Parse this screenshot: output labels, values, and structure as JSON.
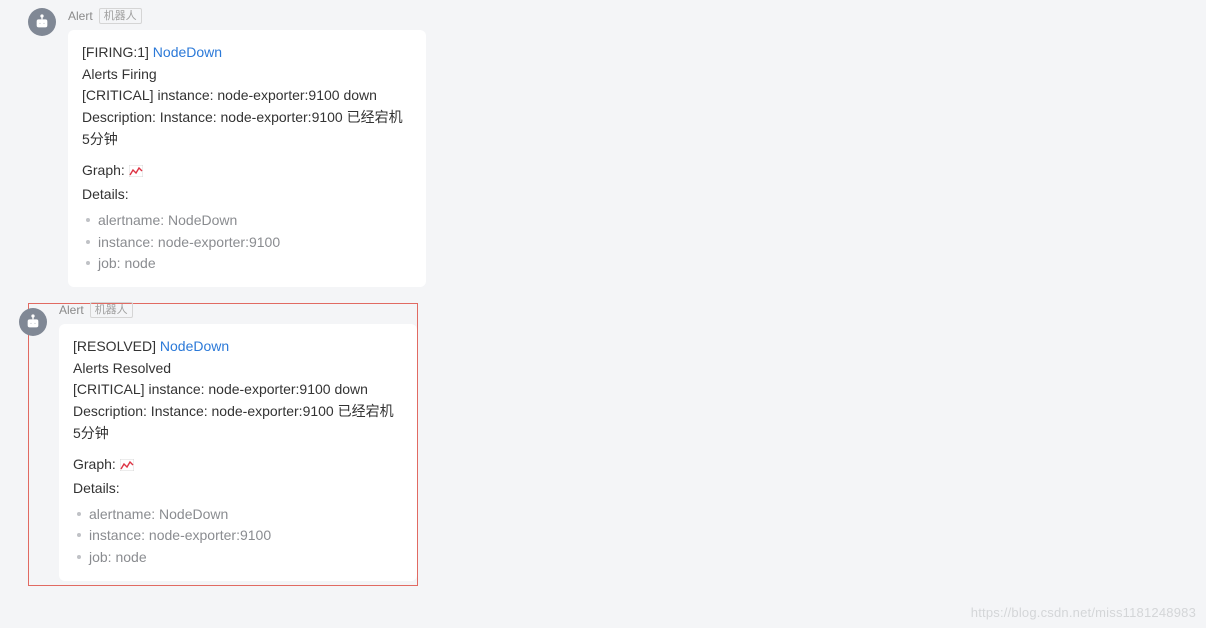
{
  "messages": [
    {
      "sender": "Alert",
      "bot_tag": "机器人",
      "status_prefix": "[FIRING:1] ",
      "link_text": "NodeDown",
      "status_text": "Alerts Firing",
      "critical_line": "[CRITICAL] instance: node-exporter:9100 down",
      "description_line": "Description: Instance: node-exporter:9100 已经宕机 5分钟",
      "graph_label": "Graph: ",
      "details_label": "Details:",
      "details": [
        "alertname: NodeDown",
        "instance: node-exporter:9100",
        "job: node"
      ]
    },
    {
      "sender": "Alert",
      "bot_tag": "机器人",
      "status_prefix": "[RESOLVED] ",
      "link_text": "NodeDown",
      "status_text": "Alerts Resolved",
      "critical_line": "[CRITICAL] instance: node-exporter:9100 down",
      "description_line": "Description: Instance: node-exporter:9100 已经宕机 5分钟",
      "graph_label": "Graph: ",
      "details_label": "Details:",
      "details": [
        "alertname: NodeDown",
        "instance: node-exporter:9100",
        "job: node"
      ]
    }
  ],
  "watermark": "https://blog.csdn.net/miss1181248983"
}
